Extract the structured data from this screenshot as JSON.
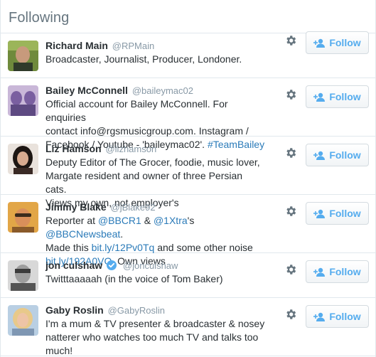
{
  "header": {
    "title": "Following"
  },
  "follow_label": "Follow",
  "colors": {
    "link": "#2b7bb9",
    "follow_text": "#55acee",
    "handle": "#8899a6",
    "verified": "#55acee"
  },
  "users": [
    {
      "name": "Richard Main",
      "handle": "@RPMain",
      "verified": false,
      "bio": [
        {
          "text": "Broadcaster, Journalist, Producer, Londoner."
        }
      ]
    },
    {
      "name": "Bailey McConnell",
      "handle": "@baileymac02",
      "verified": false,
      "bio": [
        {
          "text": "Official account for Bailey McConnell. For enquiries"
        },
        {
          "text": "contact info@rgsmusicgroup.com. Instagram /"
        },
        {
          "text": "Facebook / Youtube - 'baileymac02'. ",
          "link": "#TeamBailey"
        }
      ]
    },
    {
      "name": "Liz Hamson",
      "handle": "@lizhamson",
      "verified": false,
      "bio": [
        {
          "text": "Deputy Editor of The Grocer, foodie, music lover,"
        },
        {
          "text": "Margate resident and owner of three Persian cats."
        },
        {
          "text": "Views my own, not employer's"
        }
      ]
    },
    {
      "name": "Jimmy Blake",
      "handle": "@jBlake92",
      "verified": false,
      "bio_parts": {
        "l1_a": "Reporter at ",
        "l1_link1": "@BBCR1",
        "l1_b": " & ",
        "l1_link2": "@1Xtra",
        "l1_c": "'s ",
        "l1_link3": "@BBCNewsbeat",
        "l1_d": ".",
        "l2_a": "Made this ",
        "l2_link": "bit.ly/12Pv0Tq",
        "l2_b": " and some other noise",
        "l3_link": "bit.ly/192A0VO",
        "l3_b": ". Own views"
      }
    },
    {
      "name": "jon culshaw",
      "handle": "@jonculshaw",
      "verified": true,
      "bio": [
        {
          "text": "Twitttaaaaah (in the voice of Tom Baker)"
        }
      ]
    },
    {
      "name": "Gaby Roslin",
      "handle": "@GabyRoslin",
      "verified": false,
      "bio": [
        {
          "text": "I'm a mum & TV presenter & broadcaster & nosey"
        },
        {
          "text": "natterer who watches too much TV and talks too"
        },
        {
          "text": "much!"
        }
      ]
    }
  ]
}
